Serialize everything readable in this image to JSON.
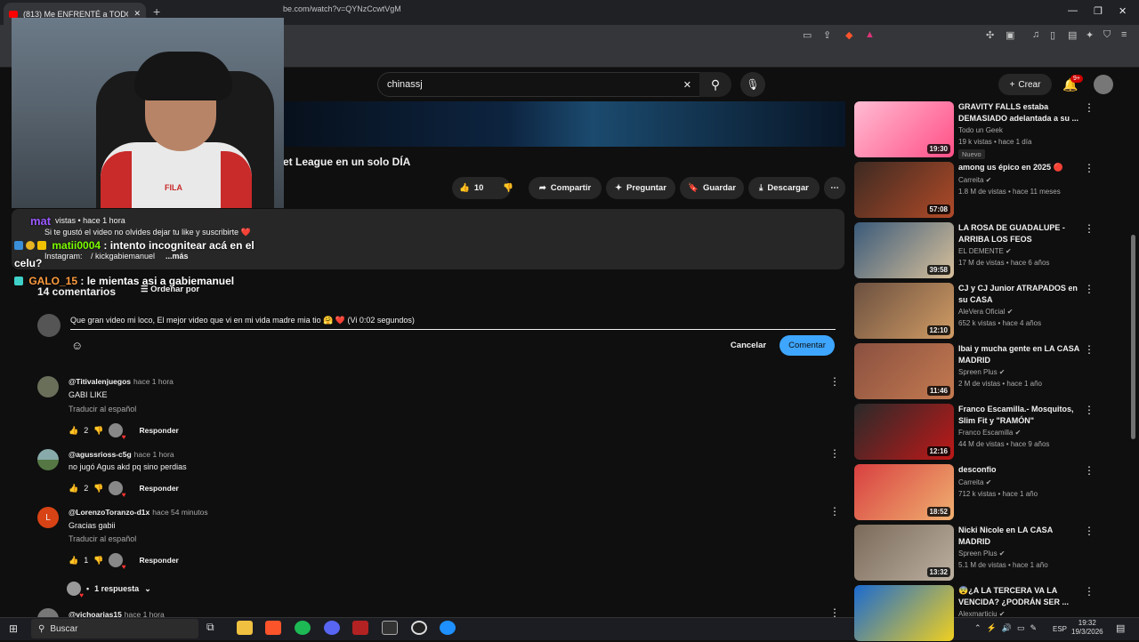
{
  "browser": {
    "tab_title": "(813) Me ENFRENTÉ a TODOS lo",
    "url": "be.com/watch?v=QYNzCcwtVgM"
  },
  "yt": {
    "search_value": "chinassj",
    "create_label": "Crear",
    "bell_badge": "9+"
  },
  "video": {
    "title_fragment": "et League en un solo DÍA",
    "likes": "10",
    "share": "Compartir",
    "ask": "Preguntar",
    "save": "Guardar",
    "download": "Descargar"
  },
  "description": {
    "line1": "vistas • hace 1 hora",
    "line2": "Si te gustó el video no olvides dejar tu like y suscribirte ❤️",
    "line3_label": "Instagram:",
    "line3_value": "/ kickgabiemanuel",
    "more": "...más"
  },
  "chat": [
    {
      "user": "matii0004",
      "text": ": intento incognitear acá en el celu?"
    },
    {
      "user": "GALO_15",
      "text": ": le mientas asi a gabiemanuel"
    },
    {
      "user": "mat",
      "text": ""
    }
  ],
  "comments_header": {
    "count": "14 comentarios",
    "sort": "Ordenar por"
  },
  "composer": {
    "value": "Que gran video mi loco, El mejor video que vi en mi vida madre mia tio 🤗 ❤️ (Vi 0:02 segundos)",
    "cancel": "Cancelar",
    "submit": "Comentar"
  },
  "comments": [
    {
      "user": "@Titivalenjuegos",
      "time": "hace 1 hora",
      "text": "GABI LIKE",
      "translate": "Traducir al español",
      "likes": "2",
      "reply": "Responder"
    },
    {
      "user": "@agussrioss-c5g",
      "time": "hace 1 hora",
      "text": "no jugó Agus akd pq sino perdias",
      "translate": "",
      "likes": "2",
      "reply": "Responder"
    },
    {
      "user": "@LorenzoToranzo-d1x",
      "time": "hace 54 minutos",
      "text": "Gracias gabii",
      "translate": "Traducir al español",
      "likes": "1",
      "reply": "Responder"
    },
    {
      "user": "@vichoarias15",
      "time": "hace 1 hora",
      "text": "",
      "translate": "",
      "likes": "",
      "reply": ""
    }
  ],
  "replies_label": "1 respuesta",
  "sidebar": [
    {
      "title": "GRAVITY FALLS estaba DEMASIADO adelantada a su ...",
      "channel": "Todo un Geek",
      "meta": "19 k vistas • hace 1 día",
      "dur": "19:30",
      "badge": "Nuevo"
    },
    {
      "title": "among us épico en 2025 🔴",
      "channel": "Carreita ✔",
      "meta": "1.8 M de vistas • hace 11 meses",
      "dur": "57:08",
      "badge": ""
    },
    {
      "title": "LA ROSA DE GUADALUPE - ARRIBA LOS FEOS",
      "channel": "EL DEMENTE ✔",
      "meta": "17 M de vistas • hace 6 años",
      "dur": "39:58",
      "badge": ""
    },
    {
      "title": "CJ y CJ Junior ATRAPADOS en su CASA",
      "channel": "AleVera Oficial ✔",
      "meta": "652 k vistas • hace 4 años",
      "dur": "12:10",
      "badge": ""
    },
    {
      "title": "Ibai y mucha gente en LA CASA MADRID",
      "channel": "Spreen Plus ✔",
      "meta": "2 M de vistas • hace 1 año",
      "dur": "11:46",
      "badge": ""
    },
    {
      "title": "Franco Escamilla.- Mosquitos, Slim Fit y \"RAMÓN\"",
      "channel": "Franco Escamilla ✔",
      "meta": "44 M de vistas • hace 9 años",
      "dur": "12:16",
      "badge": ""
    },
    {
      "title": "desconfio",
      "channel": "Carreita ✔",
      "meta": "712 k vistas • hace 1 año",
      "dur": "18:52",
      "badge": ""
    },
    {
      "title": "Nicki Nicole en LA CASA MADRID",
      "channel": "Spreen Plus ✔",
      "meta": "5.1 M de vistas • hace 1 año",
      "dur": "13:32",
      "badge": ""
    },
    {
      "title": "😨¿A LA TERCERA VA LA VENCIDA? ¿PODRÁN SER ...",
      "channel": "Alexmarticiu ✔",
      "meta": "",
      "dur": "",
      "badge": ""
    }
  ],
  "taskbar": {
    "search": "Buscar",
    "lang": "ESP",
    "time": "19:32",
    "date": "19/3/2026"
  },
  "colors": {
    "bg": "#0f0f0f",
    "accent_blue": "#3ea6ff",
    "youtube_red": "#ff0000"
  }
}
